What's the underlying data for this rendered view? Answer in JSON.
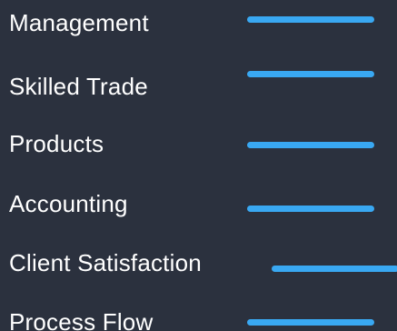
{
  "skills": [
    {
      "label": "Management",
      "level": 100
    },
    {
      "label": "Skilled Trade",
      "level": 100
    },
    {
      "label": "Products",
      "level": 100
    },
    {
      "label": "Accounting",
      "level": 100
    },
    {
      "label": "Client Satisfaction",
      "level": 100
    },
    {
      "label": "Process Flow",
      "level": 100
    }
  ],
  "colors": {
    "background": "#2b313e",
    "text": "#ffffff",
    "bar": "#39a8f2"
  }
}
